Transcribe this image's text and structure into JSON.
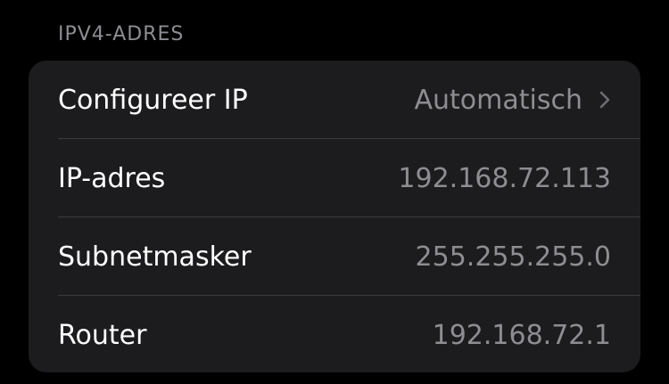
{
  "section": {
    "header": "IPV4-ADRES"
  },
  "rows": [
    {
      "label": "Configureer IP",
      "value": "Automatisch",
      "icon": "chevron-right-icon"
    },
    {
      "label": "IP-adres",
      "value": "192.168.72.113"
    },
    {
      "label": "Subnetmasker",
      "value": "255.255.255.0"
    },
    {
      "label": "Router",
      "value": "192.168.72.1"
    }
  ],
  "colors": {
    "background": "#000000",
    "group_background": "#1c1c1e",
    "label_text": "#ffffff",
    "secondary_text": "#8d8d92",
    "separator": "#3a3a3c"
  }
}
